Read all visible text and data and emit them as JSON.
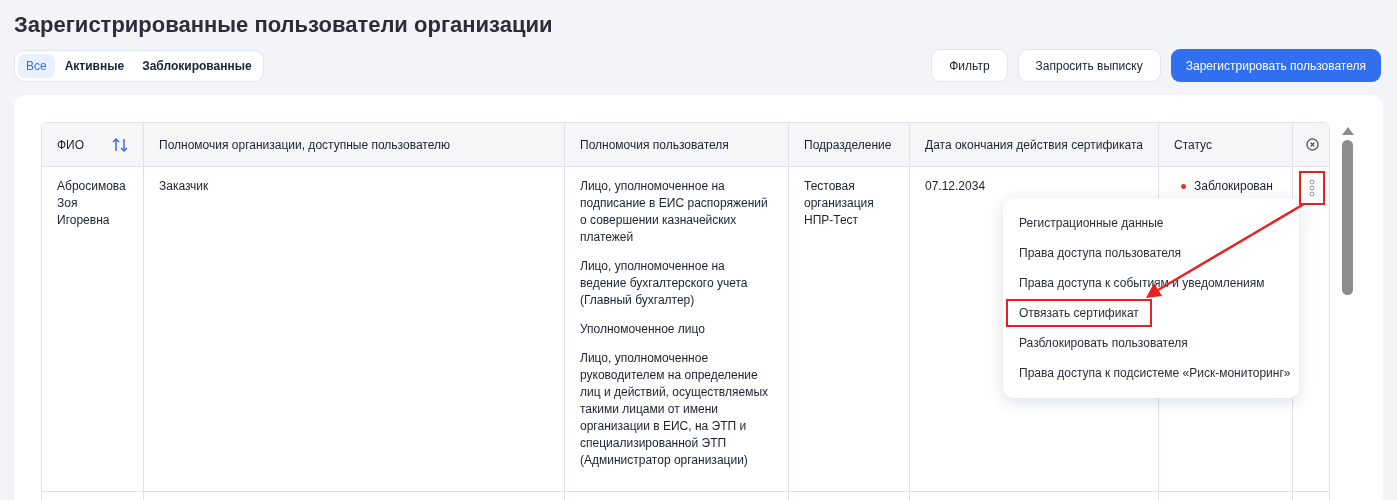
{
  "title": "Зарегистрированные пользователи организации",
  "tabs": [
    {
      "label": "Все",
      "selected": true
    },
    {
      "label": "Активные",
      "selected": false
    },
    {
      "label": "Заблокированные",
      "selected": false
    }
  ],
  "buttons": [
    {
      "label": "Фильтр",
      "kind": "secondary"
    },
    {
      "label": "Запросить выписку",
      "kind": "secondary"
    },
    {
      "label": "Зарегистрировать пользователя",
      "kind": "primary"
    }
  ],
  "table": {
    "columns": [
      {
        "label": "ФИО",
        "sortable": true
      },
      {
        "label": "Полномочия организации, доступные пользователю"
      },
      {
        "label": "Полномочия пользователя"
      },
      {
        "label": "Подразделение"
      },
      {
        "label": "Дата окончания действия сертификата"
      },
      {
        "label": "Статус"
      }
    ],
    "rows": [
      {
        "fio": "Абросимова Зоя Игоревна",
        "org_powers": [
          "Заказчик"
        ],
        "user_powers": [
          "Лицо, уполномоченное на подписание в ЕИС распоряжений о совершении казначейских платежей",
          "Лицо, уполномоченное на ведение бухгалтерского учета (Главный бухгалтер)",
          "Уполномоченное лицо",
          "Лицо, уполномоченное руководителем на определение лиц и действий, осуществляемых такими лицами от имени организации в ЕИС, на ЭТП и специализированной ЭТП (Администратор организации)"
        ],
        "department": "Тестовая организация НПР-Тест",
        "cert_end": "07.12.2034",
        "status": {
          "text": "Заблокирован",
          "color": "#e5322d"
        },
        "actions_annotated": true
      }
    ]
  },
  "menu": {
    "items": [
      {
        "label": "Регистрационные данные",
        "annotated": false
      },
      {
        "label": "Права доступа пользователя",
        "annotated": false
      },
      {
        "label": "Права доступа к событиям и уведомлениям",
        "annotated": false
      },
      {
        "label": "Отвязать сертификат",
        "annotated": true
      },
      {
        "label": "Разблокировать пользователя",
        "annotated": false
      },
      {
        "label": "Права доступа к подсистеме «Риск-мониторинг»",
        "annotated": false
      }
    ]
  }
}
